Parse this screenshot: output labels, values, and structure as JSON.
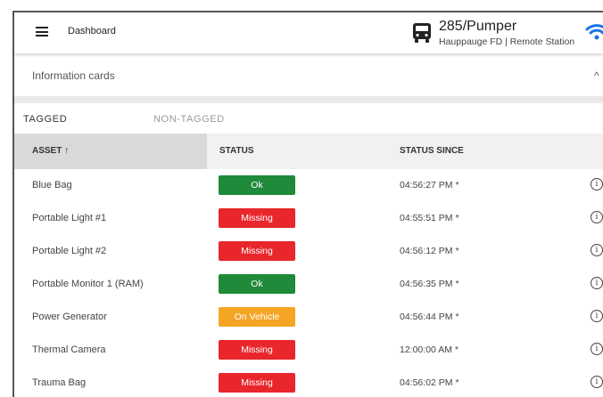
{
  "header": {
    "title": "Dashboard",
    "vehicle_name": "285/Pumper",
    "vehicle_sub": "Hauppauge FD | Remote Station",
    "icons": [
      "menu-icon",
      "bus-icon",
      "wifi-icon"
    ]
  },
  "info_cards": {
    "label": "Information cards",
    "chevron": "^"
  },
  "tabs": [
    {
      "label": "TAGGED",
      "active": true
    },
    {
      "label": "NON-TAGGED",
      "active": false
    }
  ],
  "table": {
    "headers": {
      "asset": "ASSET ↑",
      "status": "STATUS",
      "since": "STATUS SINCE"
    },
    "rows": [
      {
        "asset": "Blue Bag",
        "status": "Ok",
        "since": "04:56:27 PM *"
      },
      {
        "asset": "Portable Light #1",
        "status": "Missing",
        "since": "04:55:51 PM *"
      },
      {
        "asset": "Portable Light #2",
        "status": "Missing",
        "since": "04:56:12 PM *"
      },
      {
        "asset": "Portable Monitor 1 (RAM)",
        "status": "Ok",
        "since": "04:56:35 PM *"
      },
      {
        "asset": "Power Generator",
        "status": "On Vehicle",
        "since": "04:56:44 PM *"
      },
      {
        "asset": "Thermal Camera",
        "status": "Missing",
        "since": "12:00:00 AM *"
      },
      {
        "asset": "Trauma Bag",
        "status": "Missing",
        "since": "04:56:02 PM *"
      }
    ]
  },
  "status_colors": {
    "Ok": "#1e8a3a",
    "Missing": "#e8262b",
    "On Vehicle": "#f5a524"
  },
  "accent_color": "#1a73e8"
}
